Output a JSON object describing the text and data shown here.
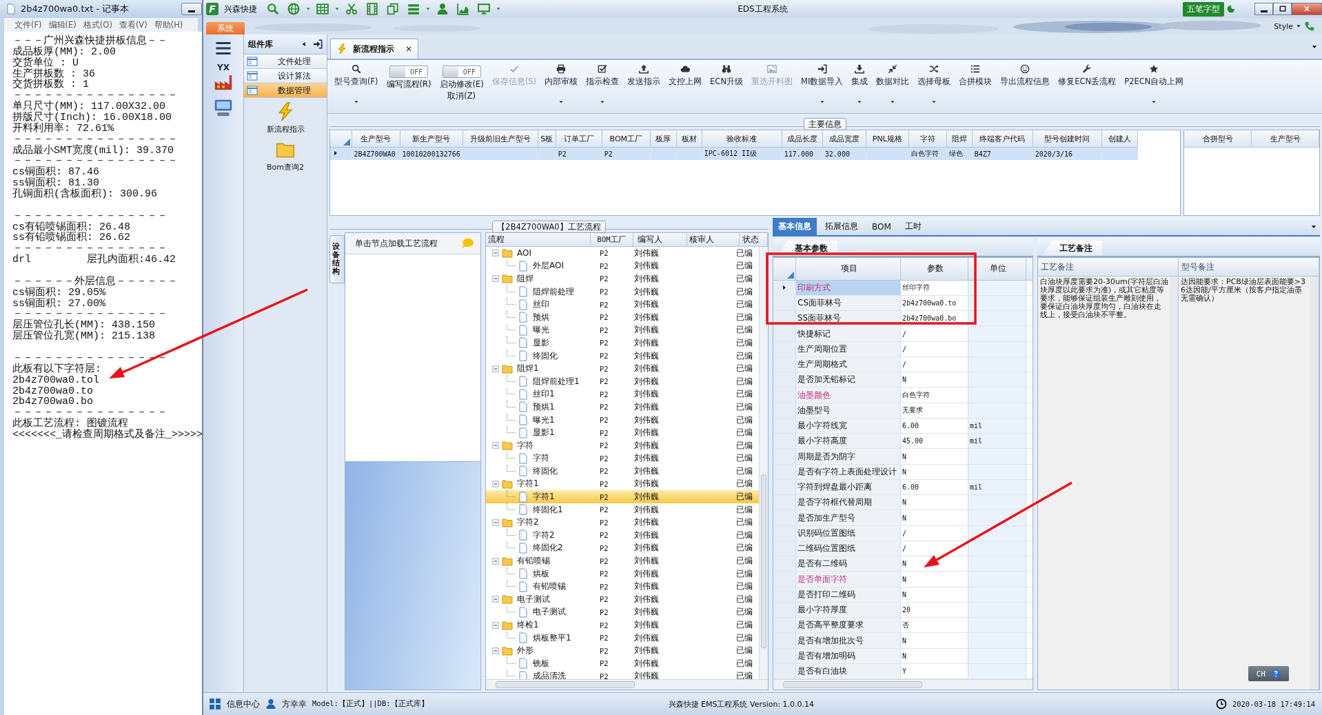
{
  "notepad": {
    "title": "2b4z700wa0.txt - 记事本",
    "menus": [
      "文件(F)",
      "编辑(E)",
      "格式(O)",
      "查看(V)",
      "帮助(H)"
    ],
    "paragraphs": [
      [
        "－－－广州兴森快捷拼板信息－－",
        "成品板厚(MM): 2.00",
        "交货单位 : U",
        "生产拼板数 : 36",
        "交货拼板数 : 1",
        "－－－－－－－－－－－－－－－－",
        "单只尺寸(MM): 117.00X32.00",
        "拼版尺寸(Inch): 16.00X18.00",
        "开料利用率: 72.61%",
        "－－－－－－－－－－－－－－－－",
        "成品最小SMT宽度(mil): 39.370",
        "－－－－－－－－－－－－－－－－",
        "cs铜面积: 87.46",
        "ss铜面积: 81.30",
        "孔铜面积(含板面积): 300.96"
      ],
      [
        "－－－－－－－－－－－－－－－",
        "cs有铅喷锡面积: 26.48",
        "ss有铅喷锡面积: 26.62",
        "－－－－－－－－－－－－－－－",
        "drl         层孔内面积:46.42"
      ],
      [
        "－－－－－－外层信息－－－－－－",
        "cs铜面积: 29.05%",
        "ss铜面积: 27.00%",
        "－－－－－－－－－－－－－－－",
        "层压管位孔长(MM): 438.150",
        "层压管位孔宽(MM): 215.138"
      ],
      [
        "－－－－－－－－－－－－－－－",
        "此板有以下字符层:",
        "2b4z700wa0.tol",
        "2b4z700wa0.to",
        "2b4z700wa0.bo",
        "－－－－－－－－－－－－－－－",
        "此板工艺流程: 图镀流程",
        "<<<<<<<_请检查周期格式及备注_>>>>>"
      ]
    ]
  },
  "app": {
    "logo": "F",
    "brand": "兴森快捷",
    "title": "EDS工程系统",
    "ime": "五笔字型",
    "system_tab": "系统",
    "style_label": "Style"
  },
  "left_rail": {
    "badge": "YX"
  },
  "component_panel": {
    "title": "组件库",
    "items": [
      {
        "label": "文件处理",
        "selected": false
      },
      {
        "label": "设计算法",
        "selected": false
      },
      {
        "label": "数据管理",
        "selected": true
      }
    ],
    "tools": [
      "新流程指示",
      "Bom查询2"
    ]
  },
  "doc_tab": {
    "label": "新流程指示",
    "close": "×"
  },
  "toolbar": [
    {
      "kind": "button",
      "label": "型号查询(F)",
      "disabled": false,
      "dropdown": true
    },
    {
      "kind": "toggle",
      "label": "编写流程(R)",
      "switch_text": "OFF",
      "on": false
    },
    {
      "kind": "toggle",
      "label": "启动修改(E)",
      "sublabel": "取消(Z)",
      "switch_text": "OFF",
      "on": false
    },
    {
      "kind": "button",
      "label": "保存信息(S)",
      "disabled": true,
      "dropdown": false
    },
    {
      "kind": "button",
      "label": "内部审核",
      "disabled": false,
      "dropdown": true
    },
    {
      "kind": "button",
      "label": "指示检查",
      "disabled": false,
      "dropdown": true
    },
    {
      "kind": "button",
      "label": "发送指示",
      "disabled": false,
      "dropdown": false
    },
    {
      "kind": "button",
      "label": "文控上网",
      "disabled": false,
      "dropdown": false
    },
    {
      "kind": "button",
      "label": "ECN升级",
      "disabled": false,
      "dropdown": false
    },
    {
      "kind": "button",
      "label": "重选开料图",
      "disabled": true,
      "dropdown": false
    },
    {
      "kind": "button",
      "label": "MI数据导入",
      "disabled": false,
      "dropdown": true
    },
    {
      "kind": "button",
      "label": "集成",
      "disabled": false,
      "dropdown": true
    },
    {
      "kind": "button",
      "label": "数据对比",
      "disabled": false,
      "dropdown": true
    },
    {
      "kind": "button",
      "label": "选择母板",
      "disabled": false,
      "dropdown": true
    },
    {
      "kind": "button",
      "label": "合拼模块",
      "disabled": false,
      "dropdown": false
    },
    {
      "kind": "button",
      "label": "导出流程信息",
      "disabled": false,
      "dropdown": false
    },
    {
      "kind": "button",
      "label": "修复ECN丢流程",
      "disabled": false,
      "dropdown": false
    },
    {
      "kind": "button",
      "label": "P2ECN自动上网",
      "disabled": false,
      "dropdown": true
    }
  ],
  "main_info": {
    "title": "主要信息",
    "columns": [
      "生产型号",
      "新生产型号",
      "升级前旧生产型号",
      "S板",
      "订单工厂",
      "BOM工厂",
      "板厚",
      "板材",
      "验收标准",
      "成品长度",
      "成品宽度",
      "PNL规格",
      "字符",
      "阻焊",
      "终端客户代码",
      "型号创建时间",
      "创建人"
    ],
    "rows": [
      {
        "selected": true,
        "cells": [
          "2B4Z700WA0",
          "10010200132766",
          null,
          null,
          "P2",
          "P2",
          null,
          null,
          "IPC-6012 II级",
          "117.000",
          "32.000",
          null,
          "白色字符",
          "绿色",
          "B4Z7",
          "2020/3/16",
          null
        ]
      }
    ],
    "side_columns": [
      "合拼型号",
      "生产型号"
    ]
  },
  "process": {
    "title": "【2B4Z700WA0】工艺流程",
    "side_tab": "设备结构",
    "hint": "单击节点加载工艺流程",
    "columns": [
      "流程",
      "BOM工厂",
      "编写人",
      "核审人",
      "状态"
    ],
    "tree": [
      {
        "label": "AOI",
        "bom": "P2",
        "writer": "刘伟巍",
        "status": "已编",
        "selected": false,
        "expanded": true,
        "children": [
          {
            "label": "外层AOI",
            "bom": "P2",
            "writer": "刘伟巍",
            "status": "已编",
            "selected": false
          }
        ]
      },
      {
        "label": "阻焊",
        "bom": "P2",
        "writer": "刘伟巍",
        "status": "已编",
        "selected": false,
        "expanded": true,
        "children": [
          {
            "label": "阻焊前处理",
            "bom": "P2",
            "writer": "刘伟巍",
            "status": "已编",
            "selected": false
          },
          {
            "label": "丝印",
            "bom": "P2",
            "writer": "刘伟巍",
            "status": "已编",
            "selected": false
          },
          {
            "label": "预烘",
            "bom": "P2",
            "writer": "刘伟巍",
            "status": "已编",
            "selected": false
          },
          {
            "label": "曝光",
            "bom": "P2",
            "writer": "刘伟巍",
            "status": "已编",
            "selected": false
          },
          {
            "label": "显影",
            "bom": "P2",
            "writer": "刘伟巍",
            "status": "已编",
            "selected": false
          },
          {
            "label": "终固化",
            "bom": "P2",
            "writer": "刘伟巍",
            "status": "已编",
            "selected": false
          }
        ]
      },
      {
        "label": "阻焊1",
        "bom": "P2",
        "writer": "刘伟巍",
        "status": "已编",
        "selected": false,
        "expanded": true,
        "children": [
          {
            "label": "阻焊前处理1",
            "bom": "P2",
            "writer": "刘伟巍",
            "status": "已编",
            "selected": false
          },
          {
            "label": "丝印1",
            "bom": "P2",
            "writer": "刘伟巍",
            "status": "已编",
            "selected": false
          },
          {
            "label": "预烘1",
            "bom": "P2",
            "writer": "刘伟巍",
            "status": "已编",
            "selected": false
          },
          {
            "label": "曝光1",
            "bom": "P2",
            "writer": "刘伟巍",
            "status": "已编",
            "selected": false
          },
          {
            "label": "显影1",
            "bom": "P2",
            "writer": "刘伟巍",
            "status": "已编",
            "selected": false
          }
        ]
      },
      {
        "label": "字符",
        "bom": "P2",
        "writer": "刘伟巍",
        "status": "已编",
        "selected": false,
        "expanded": true,
        "children": [
          {
            "label": "字符",
            "bom": "P2",
            "writer": "刘伟巍",
            "status": "已编",
            "selected": false
          },
          {
            "label": "终固化",
            "bom": "P2",
            "writer": "刘伟巍",
            "status": "已编",
            "selected": false
          }
        ]
      },
      {
        "label": "字符1",
        "bom": "P2",
        "writer": "刘伟巍",
        "status": "已编",
        "selected": false,
        "expanded": true,
        "children": [
          {
            "label": "字符1",
            "bom": "P2",
            "writer": "刘伟巍",
            "status": "已编",
            "selected": true
          },
          {
            "label": "终固化1",
            "bom": "P2",
            "writer": "刘伟巍",
            "status": "已编",
            "selected": false
          }
        ]
      },
      {
        "label": "字符2",
        "bom": "P2",
        "writer": "刘伟巍",
        "status": "已编",
        "selected": false,
        "expanded": true,
        "children": [
          {
            "label": "字符2",
            "bom": "P2",
            "writer": "刘伟巍",
            "status": "已编",
            "selected": false
          },
          {
            "label": "终固化2",
            "bom": "P2",
            "writer": "刘伟巍",
            "status": "已编",
            "selected": false
          }
        ]
      },
      {
        "label": "有铅喷锡",
        "bom": "P2",
        "writer": "刘伟巍",
        "status": "已编",
        "selected": false,
        "expanded": true,
        "children": [
          {
            "label": "烘板",
            "bom": "P2",
            "writer": "刘伟巍",
            "status": "已编",
            "selected": false
          },
          {
            "label": "有铅喷锡",
            "bom": "P2",
            "writer": "刘伟巍",
            "status": "已编",
            "selected": false
          }
        ]
      },
      {
        "label": "电子测试",
        "bom": "P2",
        "writer": "刘伟巍",
        "status": "已编",
        "selected": false,
        "expanded": true,
        "children": [
          {
            "label": "电子测试",
            "bom": "P2",
            "writer": "刘伟巍",
            "status": "已编",
            "selected": false
          }
        ]
      },
      {
        "label": "终检1",
        "bom": "P2",
        "writer": "刘伟巍",
        "status": "已编",
        "selected": false,
        "expanded": true,
        "children": [
          {
            "label": "烘板整平1",
            "bom": "P2",
            "writer": "刘伟巍",
            "status": "已编",
            "selected": false
          }
        ]
      },
      {
        "label": "外形",
        "bom": "P2",
        "writer": "刘伟巍",
        "status": "已编",
        "selected": false,
        "expanded": true,
        "children": [
          {
            "label": "铣板",
            "bom": "P2",
            "writer": "刘伟巍",
            "status": "已编",
            "selected": false
          },
          {
            "label": "成品清洗",
            "bom": "P2",
            "writer": "刘伟巍",
            "status": "已编",
            "selected": false
          }
        ]
      }
    ]
  },
  "details": {
    "tabs": [
      {
        "label": "基本信息",
        "selected": true
      },
      {
        "label": "拓展信息",
        "selected": false
      },
      {
        "label": "BOM",
        "selected": false
      },
      {
        "label": "工时",
        "selected": false
      }
    ],
    "params_tab": "基本参数",
    "param_columns": [
      "项目",
      "参数",
      "单位"
    ],
    "params": [
      {
        "item": "印刷方式",
        "value": "丝印字符",
        "marked": true,
        "selected": true
      },
      {
        "item": "CS面菲林号",
        "value": "2b4z700wa0.to",
        "marked": false,
        "selected": false
      },
      {
        "item": "SS面菲林号",
        "value": "2b4z700wa0.bo",
        "marked": false,
        "selected": false
      },
      {
        "item": "快捷标记",
        "value": "/",
        "marked": false,
        "selected": false
      },
      {
        "item": "生产周期位置",
        "value": "/",
        "marked": false,
        "selected": false
      },
      {
        "item": "生产周期格式",
        "value": "/",
        "marked": false,
        "selected": false
      },
      {
        "item": "是否加无铅标记",
        "value": "N",
        "marked": false,
        "selected": false
      },
      {
        "item": "油墨颜色",
        "value": "白色字符",
        "marked": true,
        "selected": false
      },
      {
        "item": "油墨型号",
        "value": "无要求",
        "marked": false,
        "selected": false
      },
      {
        "item": "最小字符线宽",
        "value": "6.00",
        "unit": "mil",
        "marked": false,
        "selected": false
      },
      {
        "item": "最小字符高度",
        "value": "45.00",
        "unit": "mil",
        "marked": false,
        "selected": false
      },
      {
        "item": "周期是否为阴字",
        "value": "N",
        "marked": false,
        "selected": false
      },
      {
        "item": "是否有字符上表面处理设计",
        "value": "N",
        "marked": false,
        "selected": false
      },
      {
        "item": "字符到焊盘最小距离",
        "value": "6.00",
        "unit": "mil",
        "marked": false,
        "selected": false
      },
      {
        "item": "是否字符框代替周期",
        "value": "N",
        "marked": false,
        "selected": false
      },
      {
        "item": "是否加生产型号",
        "value": "N",
        "marked": false,
        "selected": false
      },
      {
        "item": "识别码位置图纸",
        "value": "/",
        "marked": false,
        "selected": false
      },
      {
        "item": "二维码位置图纸",
        "value": "/",
        "marked": false,
        "selected": false
      },
      {
        "item": "是否有二维码",
        "value": "N",
        "marked": false,
        "selected": false
      },
      {
        "item": "是否单面字符",
        "value": "N",
        "marked": true,
        "selected": false
      },
      {
        "item": "是否打印二维码",
        "value": "N",
        "marked": false,
        "selected": false
      },
      {
        "item": "最小字符厚度",
        "value": "20",
        "marked": false,
        "selected": false
      },
      {
        "item": "是否高平整度要求",
        "value": "否",
        "marked": false,
        "selected": false
      },
      {
        "item": "是否有增加批次号",
        "value": "N",
        "marked": false,
        "selected": false
      },
      {
        "item": "是否有增加明码",
        "value": "N",
        "marked": false,
        "selected": false
      },
      {
        "item": "是否有白油块",
        "value": "Y",
        "marked": false,
        "selected": false
      }
    ],
    "remarks_tab": "工艺备注",
    "remark_columns": [
      "工艺备注",
      "型号备注"
    ],
    "remarks": [
      "白油块厚度需要20-30um(字符层白油块厚度以此要求为准)，或其它粘度等要求，能够保证组装生产雕刻使用，要保证白油块厚度均匀，白油块在走线上，接受白油块不平整。",
      "达因能要求：PCB绿油层表面能要>36达因能/平方厘米（按客户指定油墨无需确认）"
    ]
  },
  "ime_bar": {
    "label": "CH"
  },
  "status_bar": {
    "info": "信息中心",
    "user": "方幸幸",
    "env": "Model:【正式】||DB:【正式库】",
    "product": "兴森快捷 EMS工程系统 Version: 1.0.0.14",
    "time": "2020-03-18 17:49:14"
  }
}
